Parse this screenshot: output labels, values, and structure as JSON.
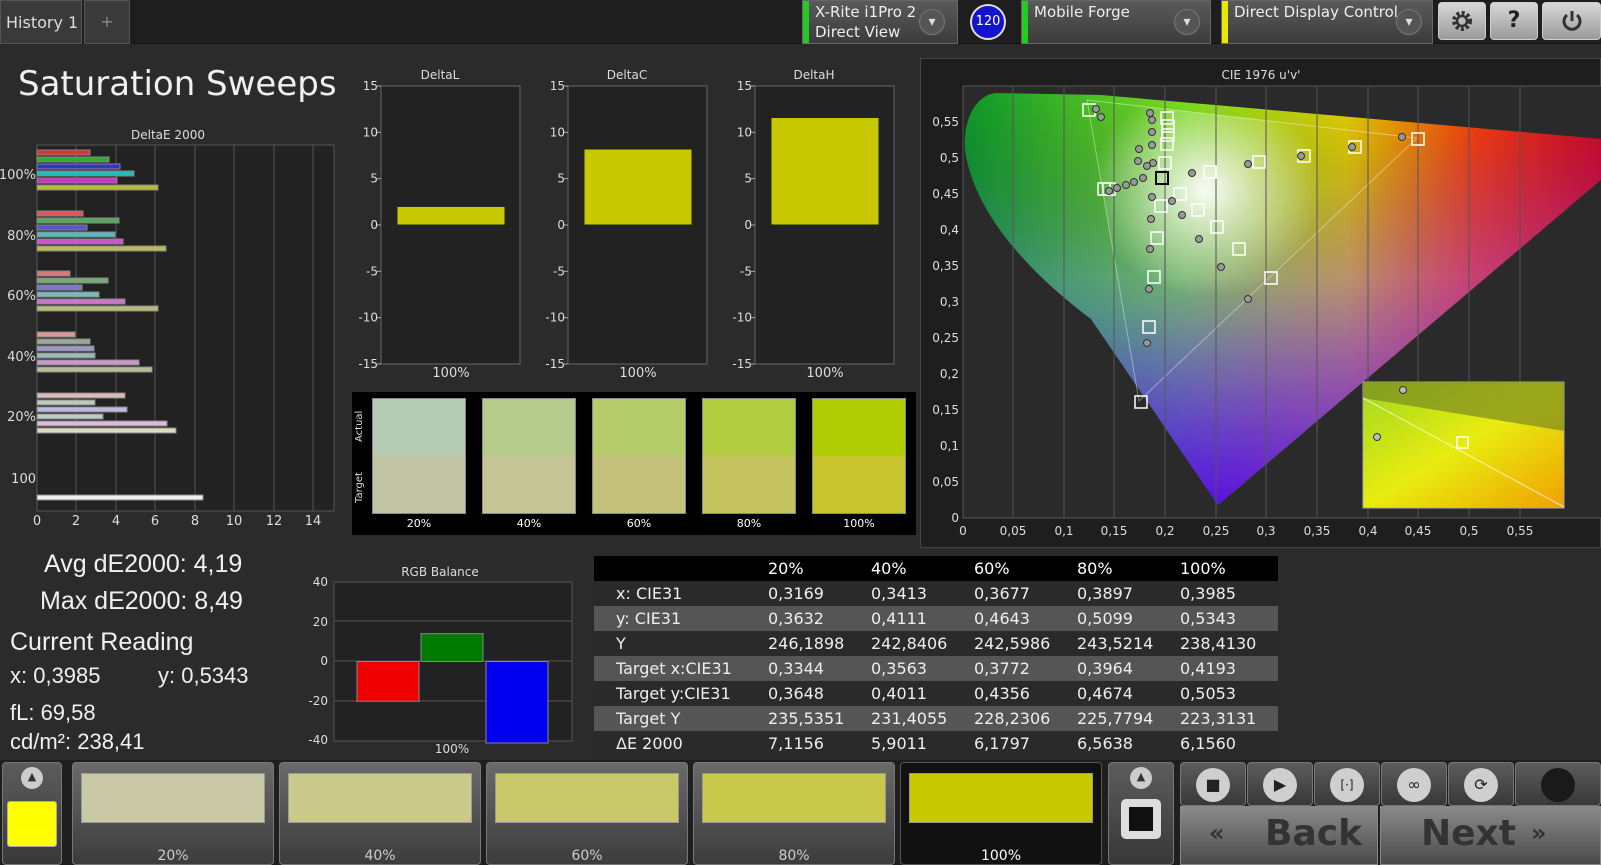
{
  "topbar": {
    "history_tab": "History 1",
    "add_tab": "+",
    "meter_line1": "X-Rite i1Pro 2",
    "meter_line2": "Direct View",
    "badge": "120",
    "workflow": "Mobile Forge",
    "display_control": "Direct Display Control",
    "settings_icon": "gear-icon",
    "help_label": "?"
  },
  "page_title": "Saturation Sweeps",
  "delta_e_chart": {
    "title": "DeltaE 2000",
    "y_labels": [
      "100%",
      "80%",
      "60%",
      "40%",
      "20%",
      "100"
    ],
    "x_ticks": [
      "0",
      "2",
      "4",
      "6",
      "8",
      "10",
      "12",
      "14"
    ]
  },
  "delta_charts": [
    {
      "title": "DeltaL",
      "value": 2.0,
      "label": "100%"
    },
    {
      "title": "DeltaC",
      "value": 8.2,
      "label": "100%"
    },
    {
      "title": "DeltaH",
      "value": 11.6,
      "label": "100%"
    }
  ],
  "delta_y_ticks": [
    "15",
    "10",
    "5",
    "0",
    "-5",
    "-10",
    "-15"
  ],
  "swatches": {
    "actual_label": "Actual",
    "target_label": "Target",
    "labels": [
      "20%",
      "40%",
      "60%",
      "80%",
      "100%"
    ]
  },
  "cie": {
    "title": "CIE 1976 u'v'",
    "x_ticks": [
      "0",
      "0,05",
      "0,1",
      "0,15",
      "0,2",
      "0,25",
      "0,3",
      "0,35",
      "0,4",
      "0,45",
      "0,5",
      "0,55"
    ],
    "y_ticks": [
      "0",
      "0,05",
      "0,1",
      "0,15",
      "0,2",
      "0,25",
      "0,3",
      "0,35",
      "0,4",
      "0,45",
      "0,5",
      "0,55"
    ]
  },
  "stats": {
    "avg": "Avg dE2000: 4,19",
    "max": "Max dE2000: 8,49",
    "current_reading": "Current Reading",
    "x": "x: 0,3985",
    "y": "y: 0,5343",
    "fl": "fL: 69,58",
    "cdm2": "cd/m²: 238,41"
  },
  "rgb_balance": {
    "title": "RGB Balance",
    "y_ticks": [
      "40",
      "20",
      "0",
      "-20",
      "-40"
    ],
    "r": -20,
    "g": 14,
    "b": -41,
    "label": "100%"
  },
  "table": {
    "headers": [
      "",
      "20%",
      "40%",
      "60%",
      "80%",
      "100%"
    ],
    "rows": [
      [
        "x: CIE31",
        "0,3169",
        "0,3413",
        "0,3677",
        "0,3897",
        "0,3985"
      ],
      [
        "y: CIE31",
        "0,3632",
        "0,4111",
        "0,4643",
        "0,5099",
        "0,5343"
      ],
      [
        "Y",
        "246,1898",
        "242,8406",
        "242,5986",
        "243,5214",
        "238,4130"
      ],
      [
        "Target x:CIE31",
        "0,3344",
        "0,3563",
        "0,3772",
        "0,3964",
        "0,4193"
      ],
      [
        "Target y:CIE31",
        "0,3648",
        "0,4011",
        "0,4356",
        "0,4674",
        "0,5053"
      ],
      [
        "Target Y",
        "235,5351",
        "231,4055",
        "228,2306",
        "225,7794",
        "223,3131"
      ],
      [
        "ΔE 2000",
        "7,1156",
        "5,9011",
        "6,1797",
        "6,5638",
        "6,1560"
      ]
    ]
  },
  "bottom": {
    "patches": [
      "20%",
      "40%",
      "60%",
      "80%",
      "100%"
    ],
    "back": "Back",
    "next": "Next",
    "current_color": "#ffff00"
  },
  "colors": {
    "accent_green": "#22cc22",
    "accent_yellow": "#e8e800",
    "bar_yellow": "#c8c800"
  }
}
